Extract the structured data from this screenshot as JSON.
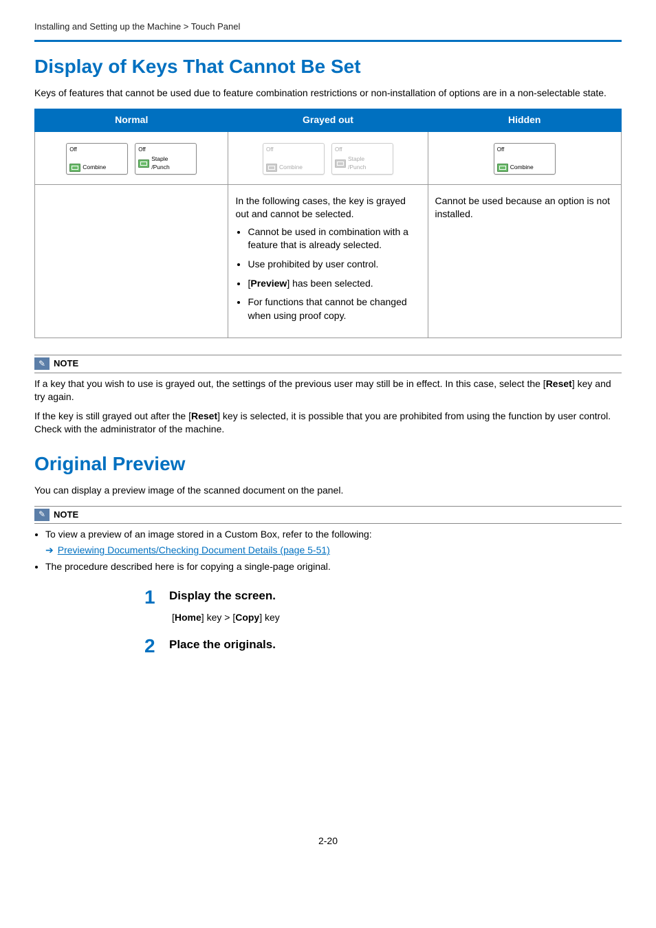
{
  "breadcrumb": "Installing and Setting up the Machine > Touch Panel",
  "section1": {
    "title": "Display of Keys That Cannot Be Set",
    "intro": "Keys of features that cannot be used due to feature combination restrictions or non-installation of options are in a non-selectable state.",
    "table": {
      "headers": {
        "c1": "Normal",
        "c2": "Grayed out",
        "c3": "Hidden"
      },
      "keys": {
        "off": "Off",
        "combine": "Combine",
        "staple": "Staple",
        "punch": "/Punch"
      },
      "grayed_intro": "In the following cases, the key is grayed out and cannot be selected.",
      "grayed_cases": [
        "Cannot be used in combination with a feature that is already selected.",
        "Use prohibited by user control.",
        "[Preview] has been selected.",
        "For functions that cannot be changed when using proof copy."
      ],
      "grayed_case3_pre": "[",
      "grayed_case3_bold": "Preview",
      "grayed_case3_post": "] has been selected.",
      "hidden_desc": "Cannot be used because an option is not installed."
    },
    "note": {
      "label": "NOTE",
      "p1_pre": "If a key that you wish to use is grayed out, the settings of the previous user may still be in effect. In this case, select the [",
      "p1_bold": "Reset",
      "p1_post": "] key and try again.",
      "p2_pre": "If the key is still grayed out after the [",
      "p2_bold": "Reset",
      "p2_post": "] key is selected, it is possible that you are prohibited from using the function by user control. Check with the administrator of the machine."
    }
  },
  "section2": {
    "title": "Original Preview",
    "intro": "You can display a preview image of the scanned document on the panel.",
    "note": {
      "label": "NOTE",
      "li1": "To view a preview of an image stored in a Custom Box, refer to the following:",
      "xref": "Previewing Documents/Checking Document Details (page 5-51)",
      "li2": "The procedure described here is for copying a single-page original."
    },
    "steps": {
      "s1_num": "1",
      "s1_title": "Display the screen.",
      "s1_body_pre": "[",
      "s1_body_b1": "Home",
      "s1_body_mid": "] key > [",
      "s1_body_b2": "Copy",
      "s1_body_post": "] key",
      "s2_num": "2",
      "s2_title": "Place the originals."
    }
  },
  "page_number": "2-20"
}
